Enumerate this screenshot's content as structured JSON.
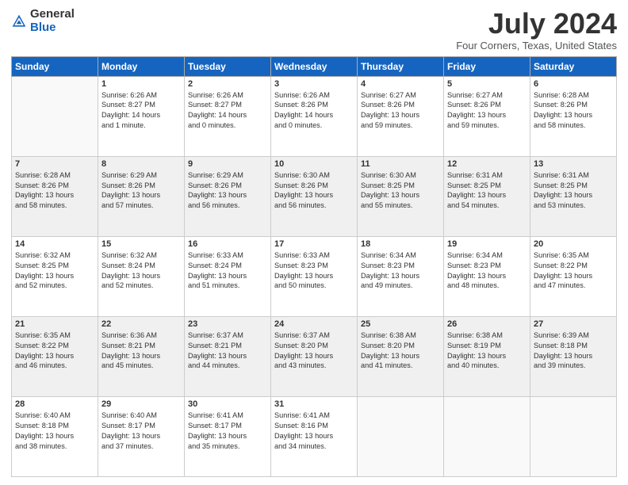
{
  "header": {
    "logo_general": "General",
    "logo_blue": "Blue",
    "month_title": "July 2024",
    "location": "Four Corners, Texas, United States"
  },
  "days_of_week": [
    "Sunday",
    "Monday",
    "Tuesday",
    "Wednesday",
    "Thursday",
    "Friday",
    "Saturday"
  ],
  "weeks": [
    [
      {
        "day": "",
        "info": ""
      },
      {
        "day": "1",
        "info": "Sunrise: 6:26 AM\nSunset: 8:27 PM\nDaylight: 14 hours\nand 1 minute."
      },
      {
        "day": "2",
        "info": "Sunrise: 6:26 AM\nSunset: 8:27 PM\nDaylight: 14 hours\nand 0 minutes."
      },
      {
        "day": "3",
        "info": "Sunrise: 6:26 AM\nSunset: 8:26 PM\nDaylight: 14 hours\nand 0 minutes."
      },
      {
        "day": "4",
        "info": "Sunrise: 6:27 AM\nSunset: 8:26 PM\nDaylight: 13 hours\nand 59 minutes."
      },
      {
        "day": "5",
        "info": "Sunrise: 6:27 AM\nSunset: 8:26 PM\nDaylight: 13 hours\nand 59 minutes."
      },
      {
        "day": "6",
        "info": "Sunrise: 6:28 AM\nSunset: 8:26 PM\nDaylight: 13 hours\nand 58 minutes."
      }
    ],
    [
      {
        "day": "7",
        "info": "Sunrise: 6:28 AM\nSunset: 8:26 PM\nDaylight: 13 hours\nand 58 minutes."
      },
      {
        "day": "8",
        "info": "Sunrise: 6:29 AM\nSunset: 8:26 PM\nDaylight: 13 hours\nand 57 minutes."
      },
      {
        "day": "9",
        "info": "Sunrise: 6:29 AM\nSunset: 8:26 PM\nDaylight: 13 hours\nand 56 minutes."
      },
      {
        "day": "10",
        "info": "Sunrise: 6:30 AM\nSunset: 8:26 PM\nDaylight: 13 hours\nand 56 minutes."
      },
      {
        "day": "11",
        "info": "Sunrise: 6:30 AM\nSunset: 8:25 PM\nDaylight: 13 hours\nand 55 minutes."
      },
      {
        "day": "12",
        "info": "Sunrise: 6:31 AM\nSunset: 8:25 PM\nDaylight: 13 hours\nand 54 minutes."
      },
      {
        "day": "13",
        "info": "Sunrise: 6:31 AM\nSunset: 8:25 PM\nDaylight: 13 hours\nand 53 minutes."
      }
    ],
    [
      {
        "day": "14",
        "info": "Sunrise: 6:32 AM\nSunset: 8:25 PM\nDaylight: 13 hours\nand 52 minutes."
      },
      {
        "day": "15",
        "info": "Sunrise: 6:32 AM\nSunset: 8:24 PM\nDaylight: 13 hours\nand 52 minutes."
      },
      {
        "day": "16",
        "info": "Sunrise: 6:33 AM\nSunset: 8:24 PM\nDaylight: 13 hours\nand 51 minutes."
      },
      {
        "day": "17",
        "info": "Sunrise: 6:33 AM\nSunset: 8:23 PM\nDaylight: 13 hours\nand 50 minutes."
      },
      {
        "day": "18",
        "info": "Sunrise: 6:34 AM\nSunset: 8:23 PM\nDaylight: 13 hours\nand 49 minutes."
      },
      {
        "day": "19",
        "info": "Sunrise: 6:34 AM\nSunset: 8:23 PM\nDaylight: 13 hours\nand 48 minutes."
      },
      {
        "day": "20",
        "info": "Sunrise: 6:35 AM\nSunset: 8:22 PM\nDaylight: 13 hours\nand 47 minutes."
      }
    ],
    [
      {
        "day": "21",
        "info": "Sunrise: 6:35 AM\nSunset: 8:22 PM\nDaylight: 13 hours\nand 46 minutes."
      },
      {
        "day": "22",
        "info": "Sunrise: 6:36 AM\nSunset: 8:21 PM\nDaylight: 13 hours\nand 45 minutes."
      },
      {
        "day": "23",
        "info": "Sunrise: 6:37 AM\nSunset: 8:21 PM\nDaylight: 13 hours\nand 44 minutes."
      },
      {
        "day": "24",
        "info": "Sunrise: 6:37 AM\nSunset: 8:20 PM\nDaylight: 13 hours\nand 43 minutes."
      },
      {
        "day": "25",
        "info": "Sunrise: 6:38 AM\nSunset: 8:20 PM\nDaylight: 13 hours\nand 41 minutes."
      },
      {
        "day": "26",
        "info": "Sunrise: 6:38 AM\nSunset: 8:19 PM\nDaylight: 13 hours\nand 40 minutes."
      },
      {
        "day": "27",
        "info": "Sunrise: 6:39 AM\nSunset: 8:18 PM\nDaylight: 13 hours\nand 39 minutes."
      }
    ],
    [
      {
        "day": "28",
        "info": "Sunrise: 6:40 AM\nSunset: 8:18 PM\nDaylight: 13 hours\nand 38 minutes."
      },
      {
        "day": "29",
        "info": "Sunrise: 6:40 AM\nSunset: 8:17 PM\nDaylight: 13 hours\nand 37 minutes."
      },
      {
        "day": "30",
        "info": "Sunrise: 6:41 AM\nSunset: 8:17 PM\nDaylight: 13 hours\nand 35 minutes."
      },
      {
        "day": "31",
        "info": "Sunrise: 6:41 AM\nSunset: 8:16 PM\nDaylight: 13 hours\nand 34 minutes."
      },
      {
        "day": "",
        "info": ""
      },
      {
        "day": "",
        "info": ""
      },
      {
        "day": "",
        "info": ""
      }
    ]
  ]
}
